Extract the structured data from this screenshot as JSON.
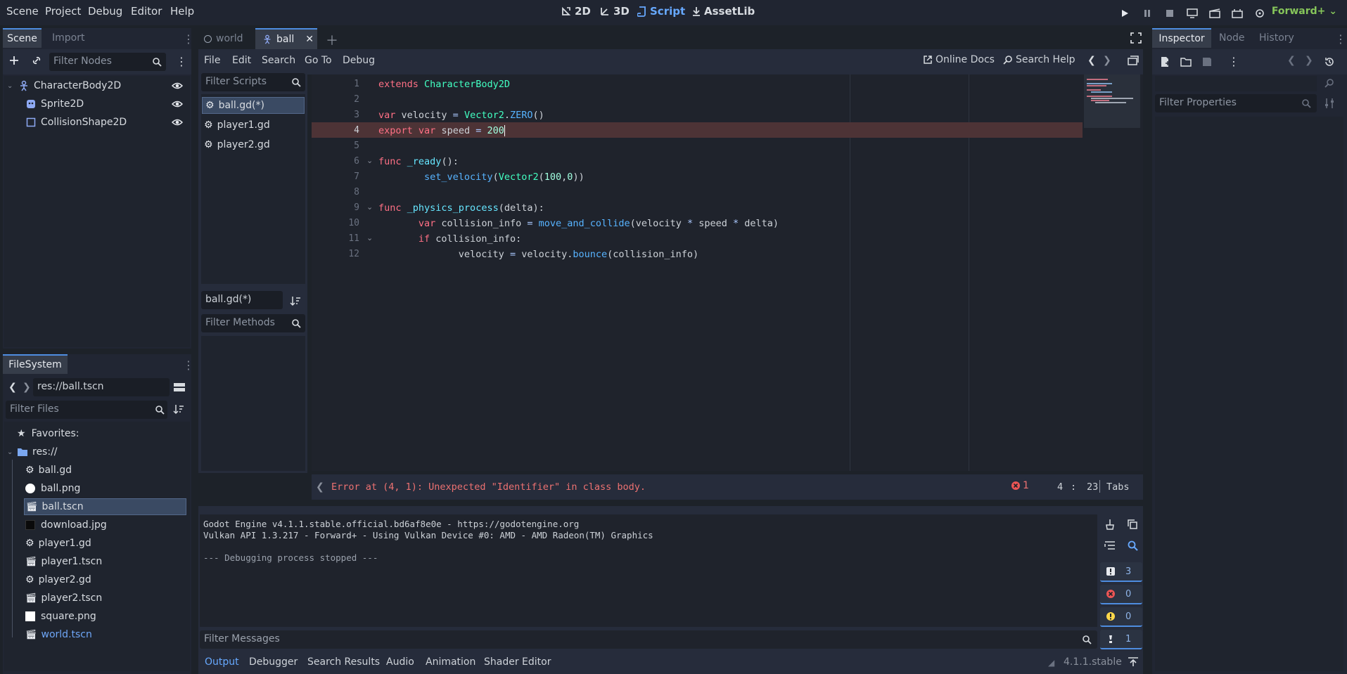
{
  "menu": [
    "Scene",
    "Project",
    "Debug",
    "Editor",
    "Help"
  ],
  "workspaces": [
    "2D",
    "3D",
    "Script",
    "AssetLib"
  ],
  "active_workspace": "Script",
  "renderer": "Forward+",
  "scene_dock": {
    "tabs": [
      "Scene",
      "Import"
    ],
    "filter_placeholder": "Filter Nodes",
    "nodes": [
      "CharacterBody2D",
      "Sprite2D",
      "CollisionShape2D"
    ]
  },
  "filesystem": {
    "tab": "FileSystem",
    "path": "res://ball.tscn",
    "filter_placeholder": "Filter Files",
    "favorites": "Favorites:",
    "root": "res://",
    "files": [
      "ball.gd",
      "ball.png",
      "ball.tscn",
      "download.jpg",
      "player1.gd",
      "player1.tscn",
      "player2.gd",
      "player2.tscn",
      "square.png",
      "world.tscn"
    ]
  },
  "scene_tabs": [
    "world",
    "ball"
  ],
  "script_menu": [
    "File",
    "Edit",
    "Search",
    "Go To",
    "Debug"
  ],
  "online_docs": "Online Docs",
  "search_help": "Search Help",
  "script_list": {
    "filter_placeholder": "Filter Scripts",
    "scripts": [
      "ball.gd(*)",
      "player1.gd",
      "player2.gd"
    ],
    "current": "ball.gd(*)",
    "methods_placeholder": "Filter Methods"
  },
  "code_lines": [
    "1",
    "2",
    "3",
    "4",
    "5",
    "6",
    "7",
    "8",
    "9",
    "10",
    "11",
    "12"
  ],
  "error_text": "Error at (4, 1): Unexpected \"Identifier\" in class body.",
  "error_count": "1",
  "cursor_line": "4",
  "cursor_sep": ":",
  "cursor_col": "23",
  "indent_mode": "Tabs",
  "output_lines": [
    "Godot Engine v4.1.1.stable.official.bd6af8e0e - https://godotengine.org",
    "Vulkan API 1.3.217 - Forward+ - Using Vulkan Device #0: AMD - AMD Radeon(TM) Graphics",
    "",
    "--- Debugging process stopped ---"
  ],
  "counters": {
    "messages": "3",
    "errors": "0",
    "warnings": "0",
    "editor": "1"
  },
  "filter_messages": "Filter Messages",
  "bottom_tabs": [
    "Output",
    "Debugger",
    "Search Results",
    "Audio",
    "Animation",
    "Shader Editor"
  ],
  "version": "4.1.1.stable",
  "inspector": {
    "tabs": [
      "Inspector",
      "Node",
      "History"
    ],
    "filter_placeholder": "Filter Properties"
  }
}
